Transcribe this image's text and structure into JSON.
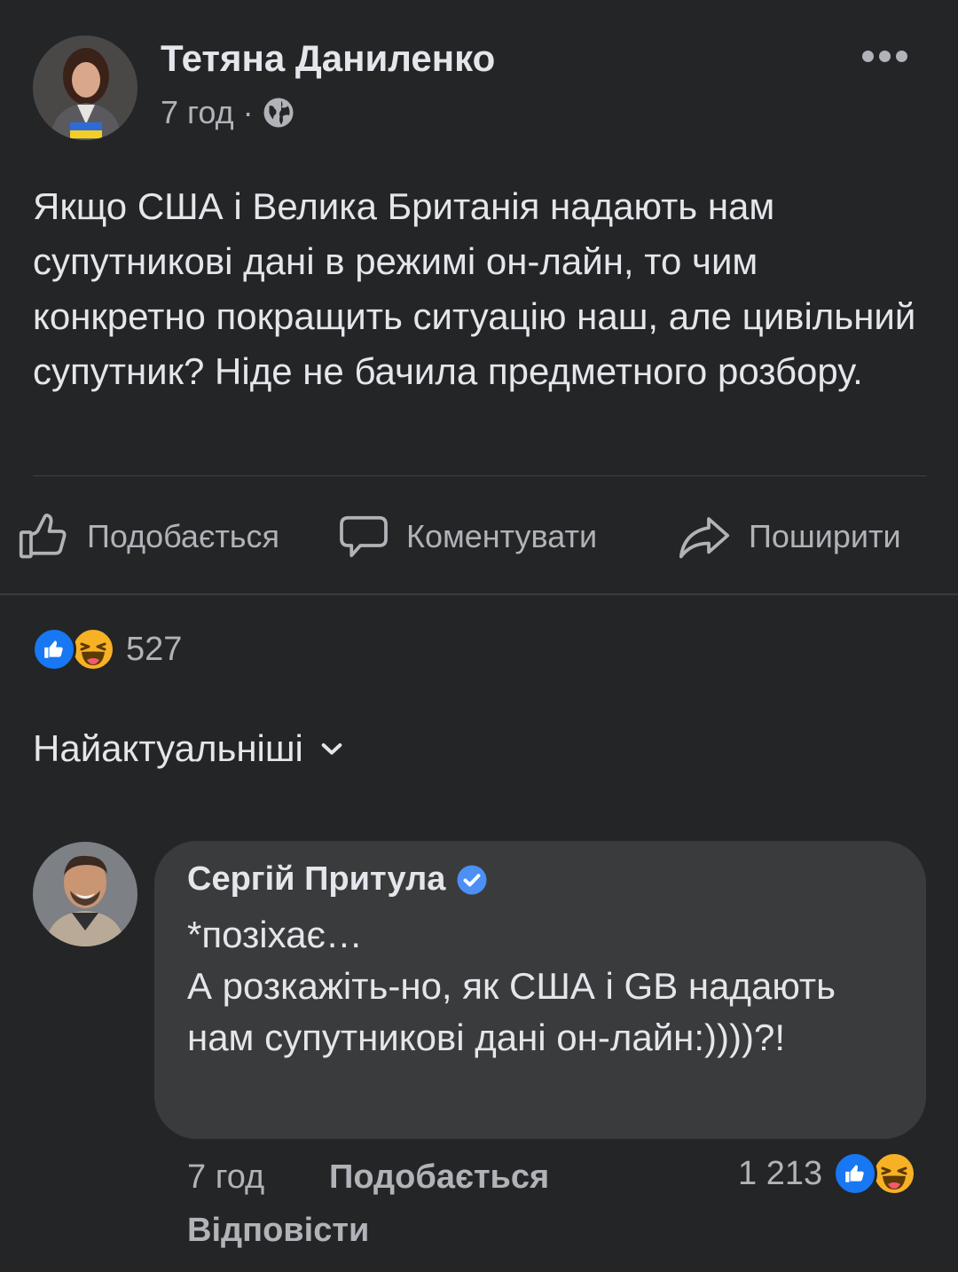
{
  "post": {
    "author": "Тетяна Даниленко",
    "time": "7 год",
    "separator": "·",
    "privacy_icon": "globe-icon",
    "more_icon": "more-horizontal-icon",
    "text": "Якщо США і Велика Британія надають нам супутникові дані в режимі он-лайн, то чим конкретно покращить ситуацію наш, але цивільний супутник? Ніде не бачила предметного розбору."
  },
  "actions": {
    "like_label": "Подобається",
    "comment_label": "Коментувати",
    "share_label": "Поширити"
  },
  "reactions": {
    "types": [
      "like",
      "haha"
    ],
    "count": "527"
  },
  "sort": {
    "label": "Найактуальніші"
  },
  "comment": {
    "author": "Сергій Притула",
    "verified": true,
    "text": "*позіхає…\nА розкажіть-но, як США і GB надають нам супутникові дані он-лайн:))))?!",
    "time": "7 год",
    "like_label": "Подобається",
    "reply_label": "Відповісти",
    "reaction_count": "1 213",
    "reaction_types": [
      "like",
      "haha"
    ]
  },
  "colors": {
    "background": "#242526",
    "bubble": "#3a3b3c",
    "primary_text": "#e4e6eb",
    "secondary_text": "#b0b3b8",
    "like_blue": "#1877f2",
    "haha_yellow": "#f7b125"
  }
}
